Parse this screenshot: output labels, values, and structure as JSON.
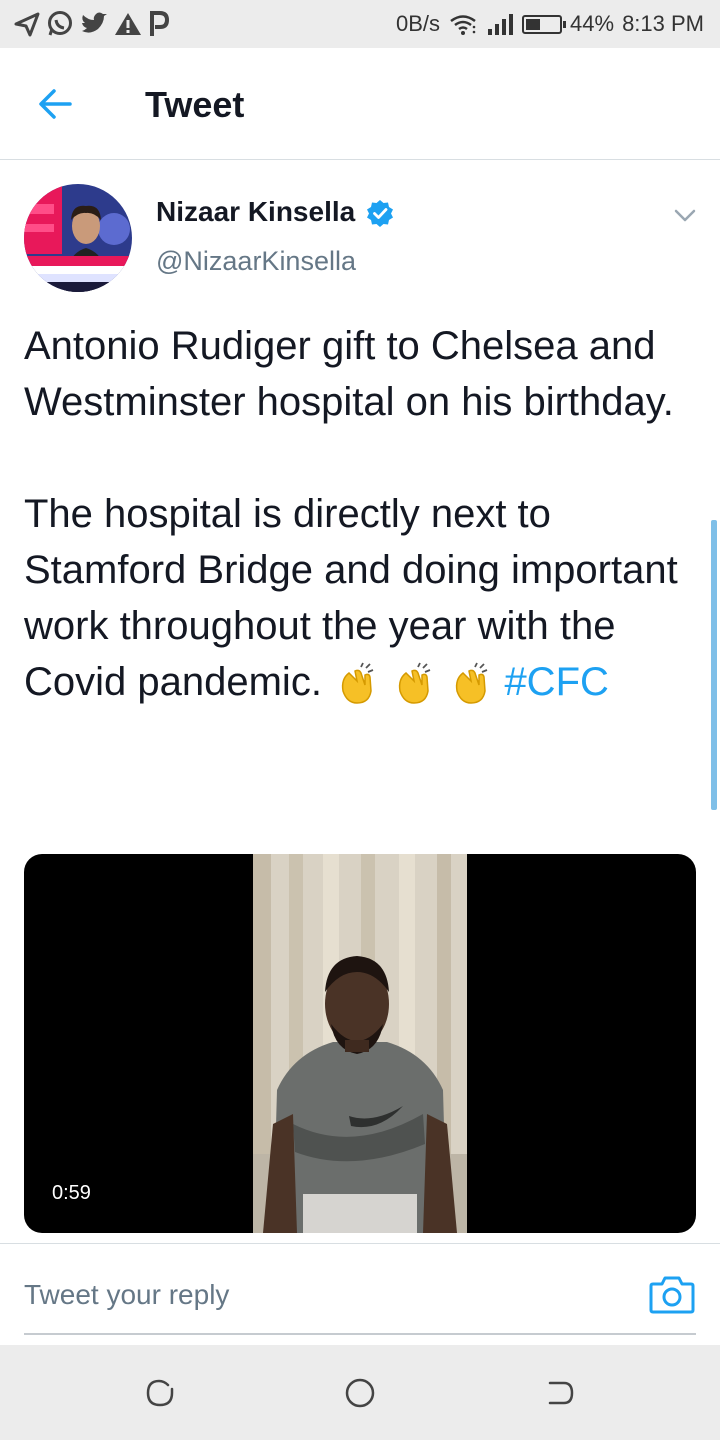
{
  "status_bar": {
    "net_speed": "0B/s",
    "battery_level": 0.44,
    "battery": "44%",
    "time": "8:13 PM",
    "left_icons": [
      "send-icon",
      "whatsapp-icon",
      "twitter-icon",
      "alert-icon",
      "p-app-icon"
    ]
  },
  "header": {
    "title": "Tweet"
  },
  "tweet": {
    "author_name": "Nizaar Kinsella",
    "author_handle": "@NizaarKinsella",
    "paragraph1": "Antonio Rudiger gift to Chelsea and Westminster hospital on his birthday.",
    "paragraph2": "The hospital is directly next to Stamford Bridge and doing important work throughout the year with the Covid pandemic.",
    "emoji": "👏",
    "emoji_count": 3,
    "hashtag": "#CFC",
    "video_duration": "0:59"
  },
  "reply": {
    "placeholder": "Tweet your reply"
  },
  "colors": {
    "accent": "#1da1f2",
    "text": "#141823",
    "secondary": "#657786",
    "status_bar_bg": "#ececec"
  }
}
